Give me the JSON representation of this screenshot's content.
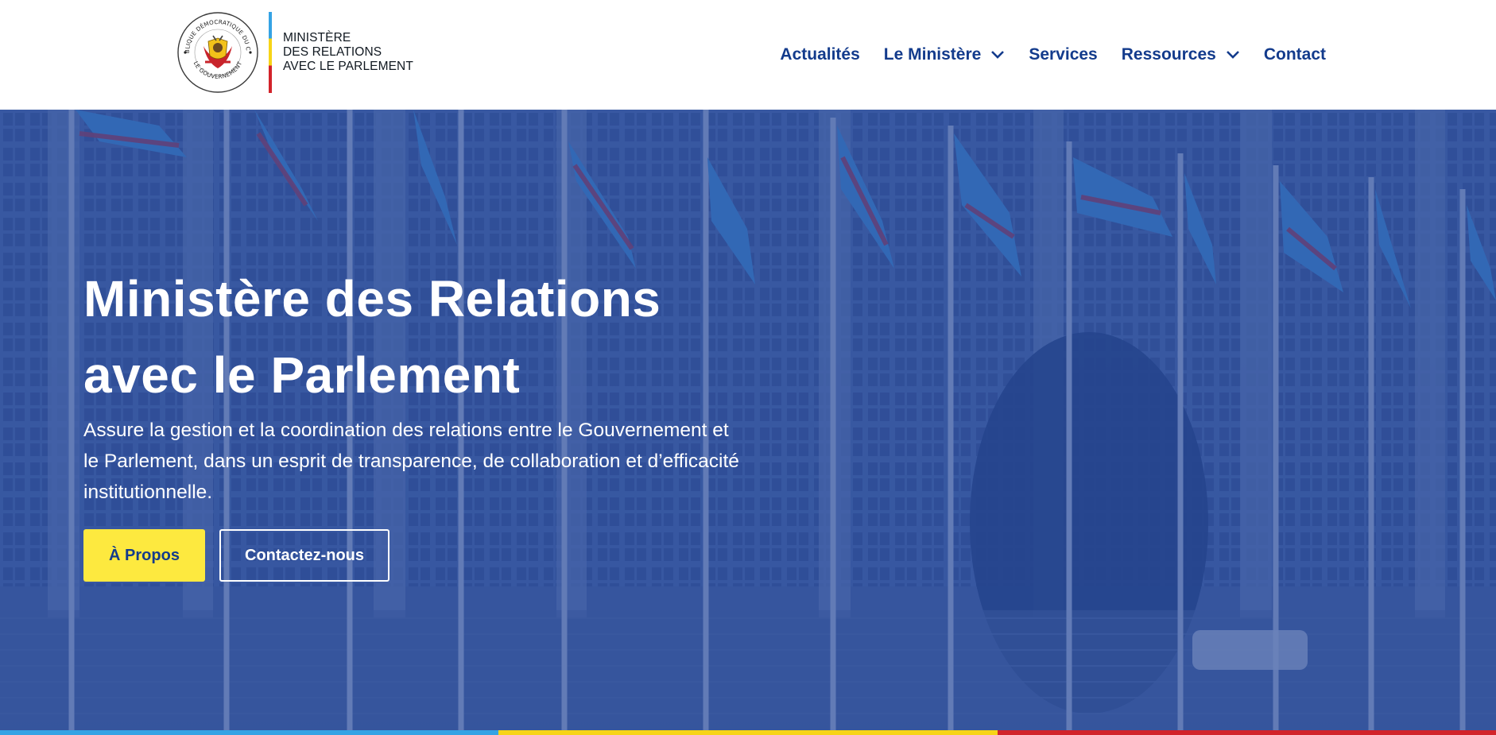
{
  "header": {
    "seal": {
      "top_text": "RÉPUBLIQUE DÉMOCRATIQUE DU CONGO",
      "bottom_text": "LE GOUVERNEMENT"
    },
    "brand_lines": [
      "MINISTÈRE",
      "DES RELATIONS",
      "AVEC LE PARLEMENT"
    ],
    "flag_colors": [
      "#35a3e4",
      "#f7d417",
      "#d2232a"
    ]
  },
  "nav": {
    "items": [
      {
        "label": "Actualités",
        "has_dropdown": false
      },
      {
        "label": "Le Ministère",
        "has_dropdown": true
      },
      {
        "label": "Services",
        "has_dropdown": false
      },
      {
        "label": "Ressources",
        "has_dropdown": true
      },
      {
        "label": "Contact",
        "has_dropdown": false
      }
    ]
  },
  "hero": {
    "title_line1": "Ministère des Relations",
    "title_line2": "avec le Parlement",
    "description": "Assure la gestion et la coordination des relations entre le Gouvernement et le Parlement, dans un esprit de transparence, de collaboration et d’efficacité institutionnelle.",
    "primary_button": "À Propos",
    "secondary_button": "Contactez-nous"
  },
  "colors": {
    "brand_blue": "#133b8c",
    "accent_yellow": "#fde93f",
    "overlay_blue": "#2446a0",
    "strip": [
      "#35a3e4",
      "#f7d417",
      "#d2232a"
    ]
  }
}
